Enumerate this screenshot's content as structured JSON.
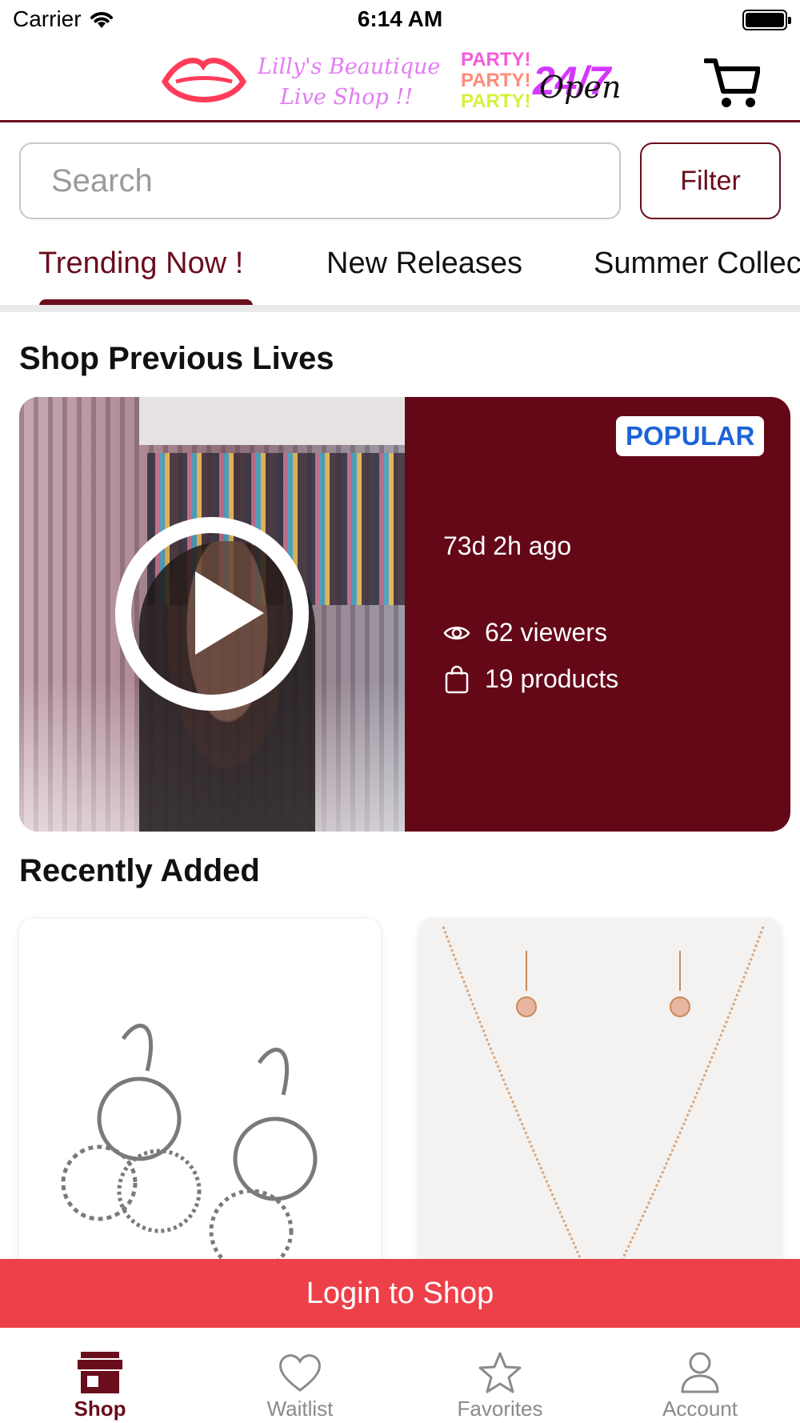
{
  "status_bar": {
    "carrier": "Carrier",
    "time": "6:14 AM"
  },
  "header": {
    "logo_text": "Lilly's Beautique Live Shop !!",
    "logo_party": [
      "PARTY!",
      "PARTY!",
      "PARTY!"
    ],
    "logo_tag": "24/7",
    "logo_open": "Open",
    "cart_icon": "cart-icon"
  },
  "search": {
    "placeholder": "Search",
    "filter_label": "Filter"
  },
  "tabs": [
    {
      "label": "Trending Now !",
      "active": true
    },
    {
      "label": "New Releases",
      "active": false
    },
    {
      "label": "Summer Collec",
      "active": false
    }
  ],
  "previous_lives": {
    "title": "Shop Previous Lives",
    "card": {
      "badge": "POPULAR",
      "ago": "73d 2h ago",
      "viewers": "62 viewers",
      "products": "19 products"
    }
  },
  "recently_added": {
    "title": "Recently Added"
  },
  "login_banner": "Login to Shop",
  "colors": {
    "brand": "#6a0d1c",
    "card_bg": "#640818",
    "banner": "#ed4049",
    "badge_text": "#1d63d8"
  },
  "bottom_nav": [
    {
      "label": "Shop",
      "icon": "store-icon",
      "active": true
    },
    {
      "label": "Waitlist",
      "icon": "heart-icon",
      "active": false
    },
    {
      "label": "Favorites",
      "icon": "star-icon",
      "active": false
    },
    {
      "label": "Account",
      "icon": "person-icon",
      "active": false
    }
  ]
}
